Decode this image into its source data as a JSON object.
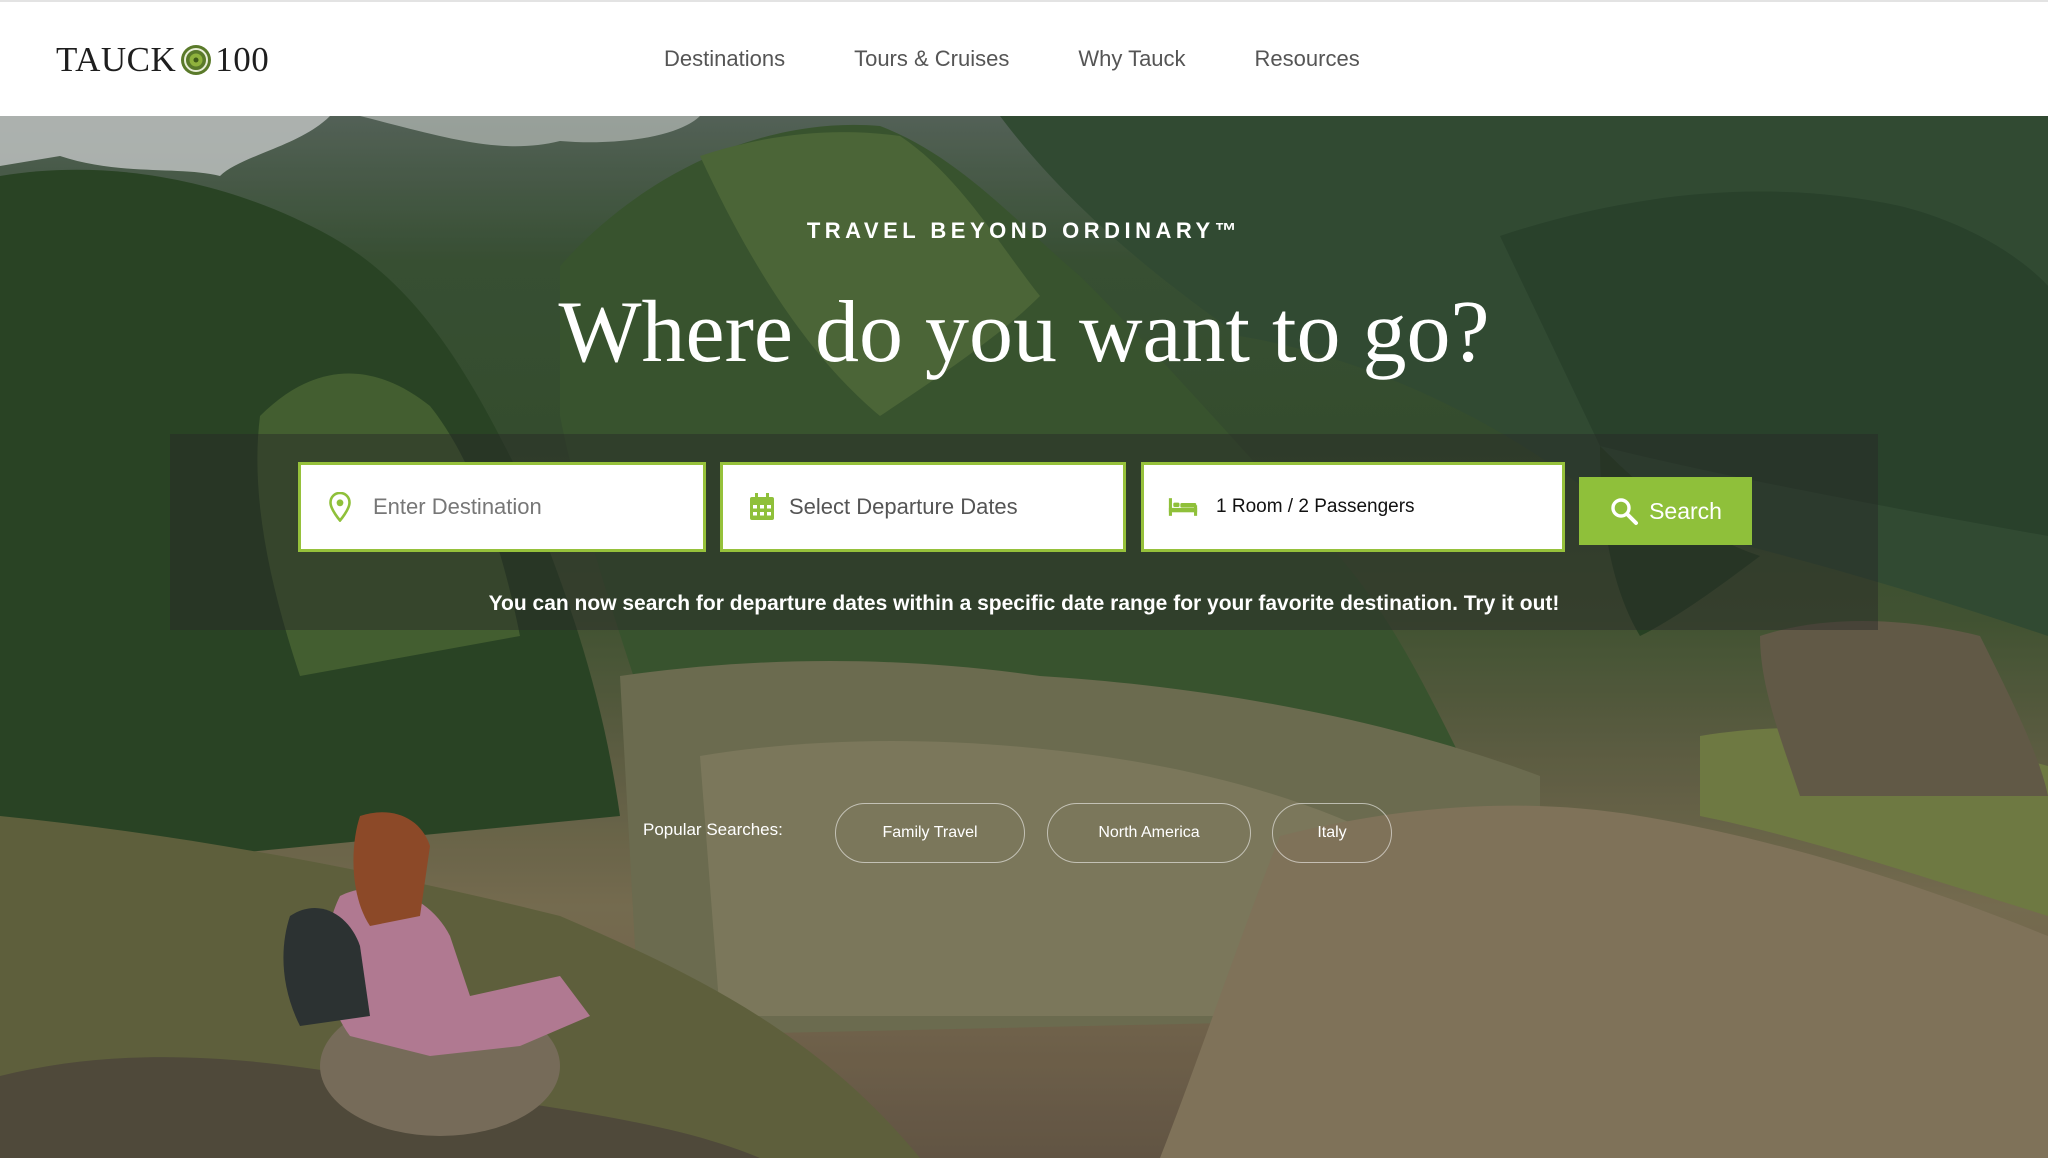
{
  "brand": {
    "logo_text_left": "TAUCK",
    "logo_text_right": "100"
  },
  "nav": {
    "items": [
      {
        "label": "Destinations"
      },
      {
        "label": "Tours & Cruises"
      },
      {
        "label": "Why Tauck"
      },
      {
        "label": "Resources"
      }
    ]
  },
  "hero": {
    "tagline": "TRAVEL BEYOND ORDINARY™",
    "headline": "Where do you want to go?"
  },
  "search": {
    "destination_placeholder": "Enter Destination",
    "dates_label": "Select Departure Dates",
    "passengers_label": "1 Room / 2 Passengers",
    "button_label": "Search",
    "notice": "You can now search for departure dates within a specific date range for your favorite destination. Try it out!"
  },
  "popular": {
    "label": "Popular Searches:",
    "items": [
      "Family Travel",
      "North America",
      "Italy"
    ]
  },
  "colors": {
    "accent": "#8fc03a",
    "field_border": "#96c13b"
  },
  "icons": {
    "destination": "location-pin-icon",
    "dates": "calendar-icon",
    "passengers": "bed-icon",
    "search": "magnifier-icon"
  }
}
